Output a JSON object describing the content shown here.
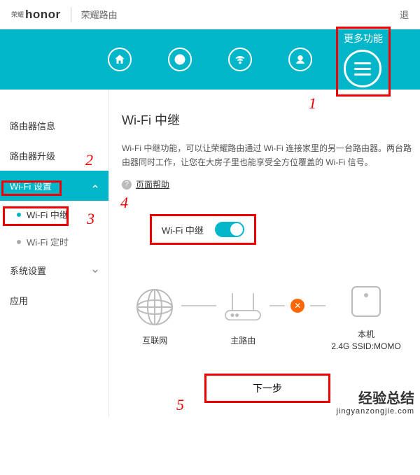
{
  "header": {
    "brand_prefix": "荣耀",
    "brand": "honor",
    "product": "荣耀路由",
    "logout": "退"
  },
  "navbar": {
    "more_label": "更多功能"
  },
  "sidebar": {
    "items": [
      {
        "label": "路由器信息"
      },
      {
        "label": "路由器升级"
      },
      {
        "label": "Wi-Fi 设置"
      },
      {
        "label": "系统设置"
      },
      {
        "label": "应用"
      }
    ],
    "wifi_sub": [
      {
        "label": "Wi-Fi 中继"
      },
      {
        "label": "Wi-Fi 定时"
      }
    ]
  },
  "main": {
    "title": "Wi-Fi 中继",
    "desc": "Wi-Fi 中继功能，可以让荣耀路由通过 Wi-Fi 连接家里的另一台路由器。两台路由器同时工作，让您在大房子里也能享受全方位覆盖的 Wi-Fi 信号。",
    "help": "页面帮助",
    "toggle_label": "Wi-Fi 中继",
    "diagram": {
      "internet": "互联网",
      "main_router": "主路由",
      "this_device": "本机",
      "ssid": "2.4G SSID:MOMO"
    },
    "next_btn": "下一步"
  },
  "annotations": {
    "n1": "1",
    "n2": "2",
    "n3": "3",
    "n4": "4",
    "n5": "5"
  },
  "watermark": {
    "main": "经验总结",
    "sub": "jingyanzongjie.com"
  }
}
